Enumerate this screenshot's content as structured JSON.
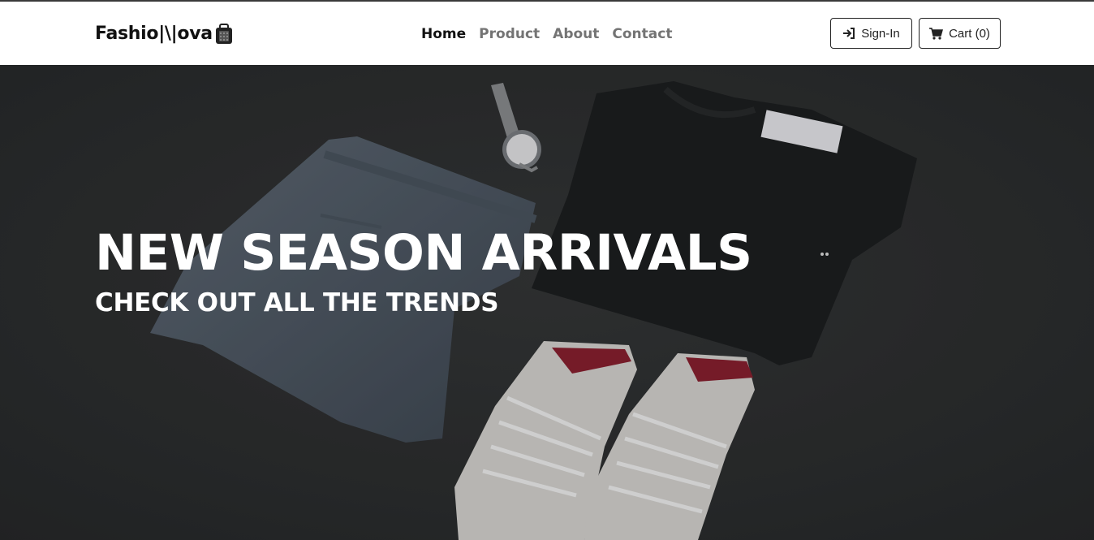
{
  "brand": {
    "name": "Fashio|\\|ova",
    "icon": "shopping-bag-icon"
  },
  "nav": {
    "links": [
      {
        "label": "Home",
        "active": true
      },
      {
        "label": "Product",
        "active": false
      },
      {
        "label": "About",
        "active": false
      },
      {
        "label": "Contact",
        "active": false
      }
    ]
  },
  "actions": {
    "signin_label": "Sign-In",
    "signin_icon": "sign-in-icon",
    "cart_label": "Cart (0)",
    "cart_icon": "cart-icon"
  },
  "hero": {
    "title": "NEW SEASON ARRIVALS",
    "subtitle": "CHECK OUT ALL THE TRENDS",
    "image_items": [
      "jeans",
      "watch",
      "t-shirt",
      "sneakers"
    ],
    "tag_text": "PLAY"
  },
  "colors": {
    "nav_bg": "#ffffff",
    "nav_active": "#111111",
    "nav_inactive": "#747474",
    "hero_bg": "#2f3133",
    "hero_text": "#ffffff"
  }
}
